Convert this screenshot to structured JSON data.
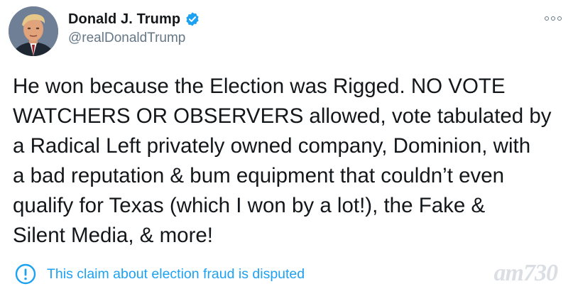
{
  "author": {
    "display_name": "Donald J. Trump",
    "handle": "@realDonaldTrump",
    "verified": true
  },
  "tweet": {
    "text": "He won because the Election was Rigged. NO VOTE\nWATCHERS OR OBSERVERS allowed, vote tabulated by\na Radical Left privately owned company, Dominion, with\na bad reputation & bum equipment that couldn’t even\nqualify for Texas (which I won by a lot!), the Fake &\nSilent Media, & more!"
  },
  "notice": {
    "text": "This claim about election fraud is disputed",
    "icon": "exclamation-circle-icon"
  },
  "menu": {
    "icon": "more-options-icon"
  },
  "watermark": {
    "text": "am730"
  },
  "colors": {
    "accent": "#1da1f2",
    "text": "#14171a",
    "secondary": "#657786"
  }
}
